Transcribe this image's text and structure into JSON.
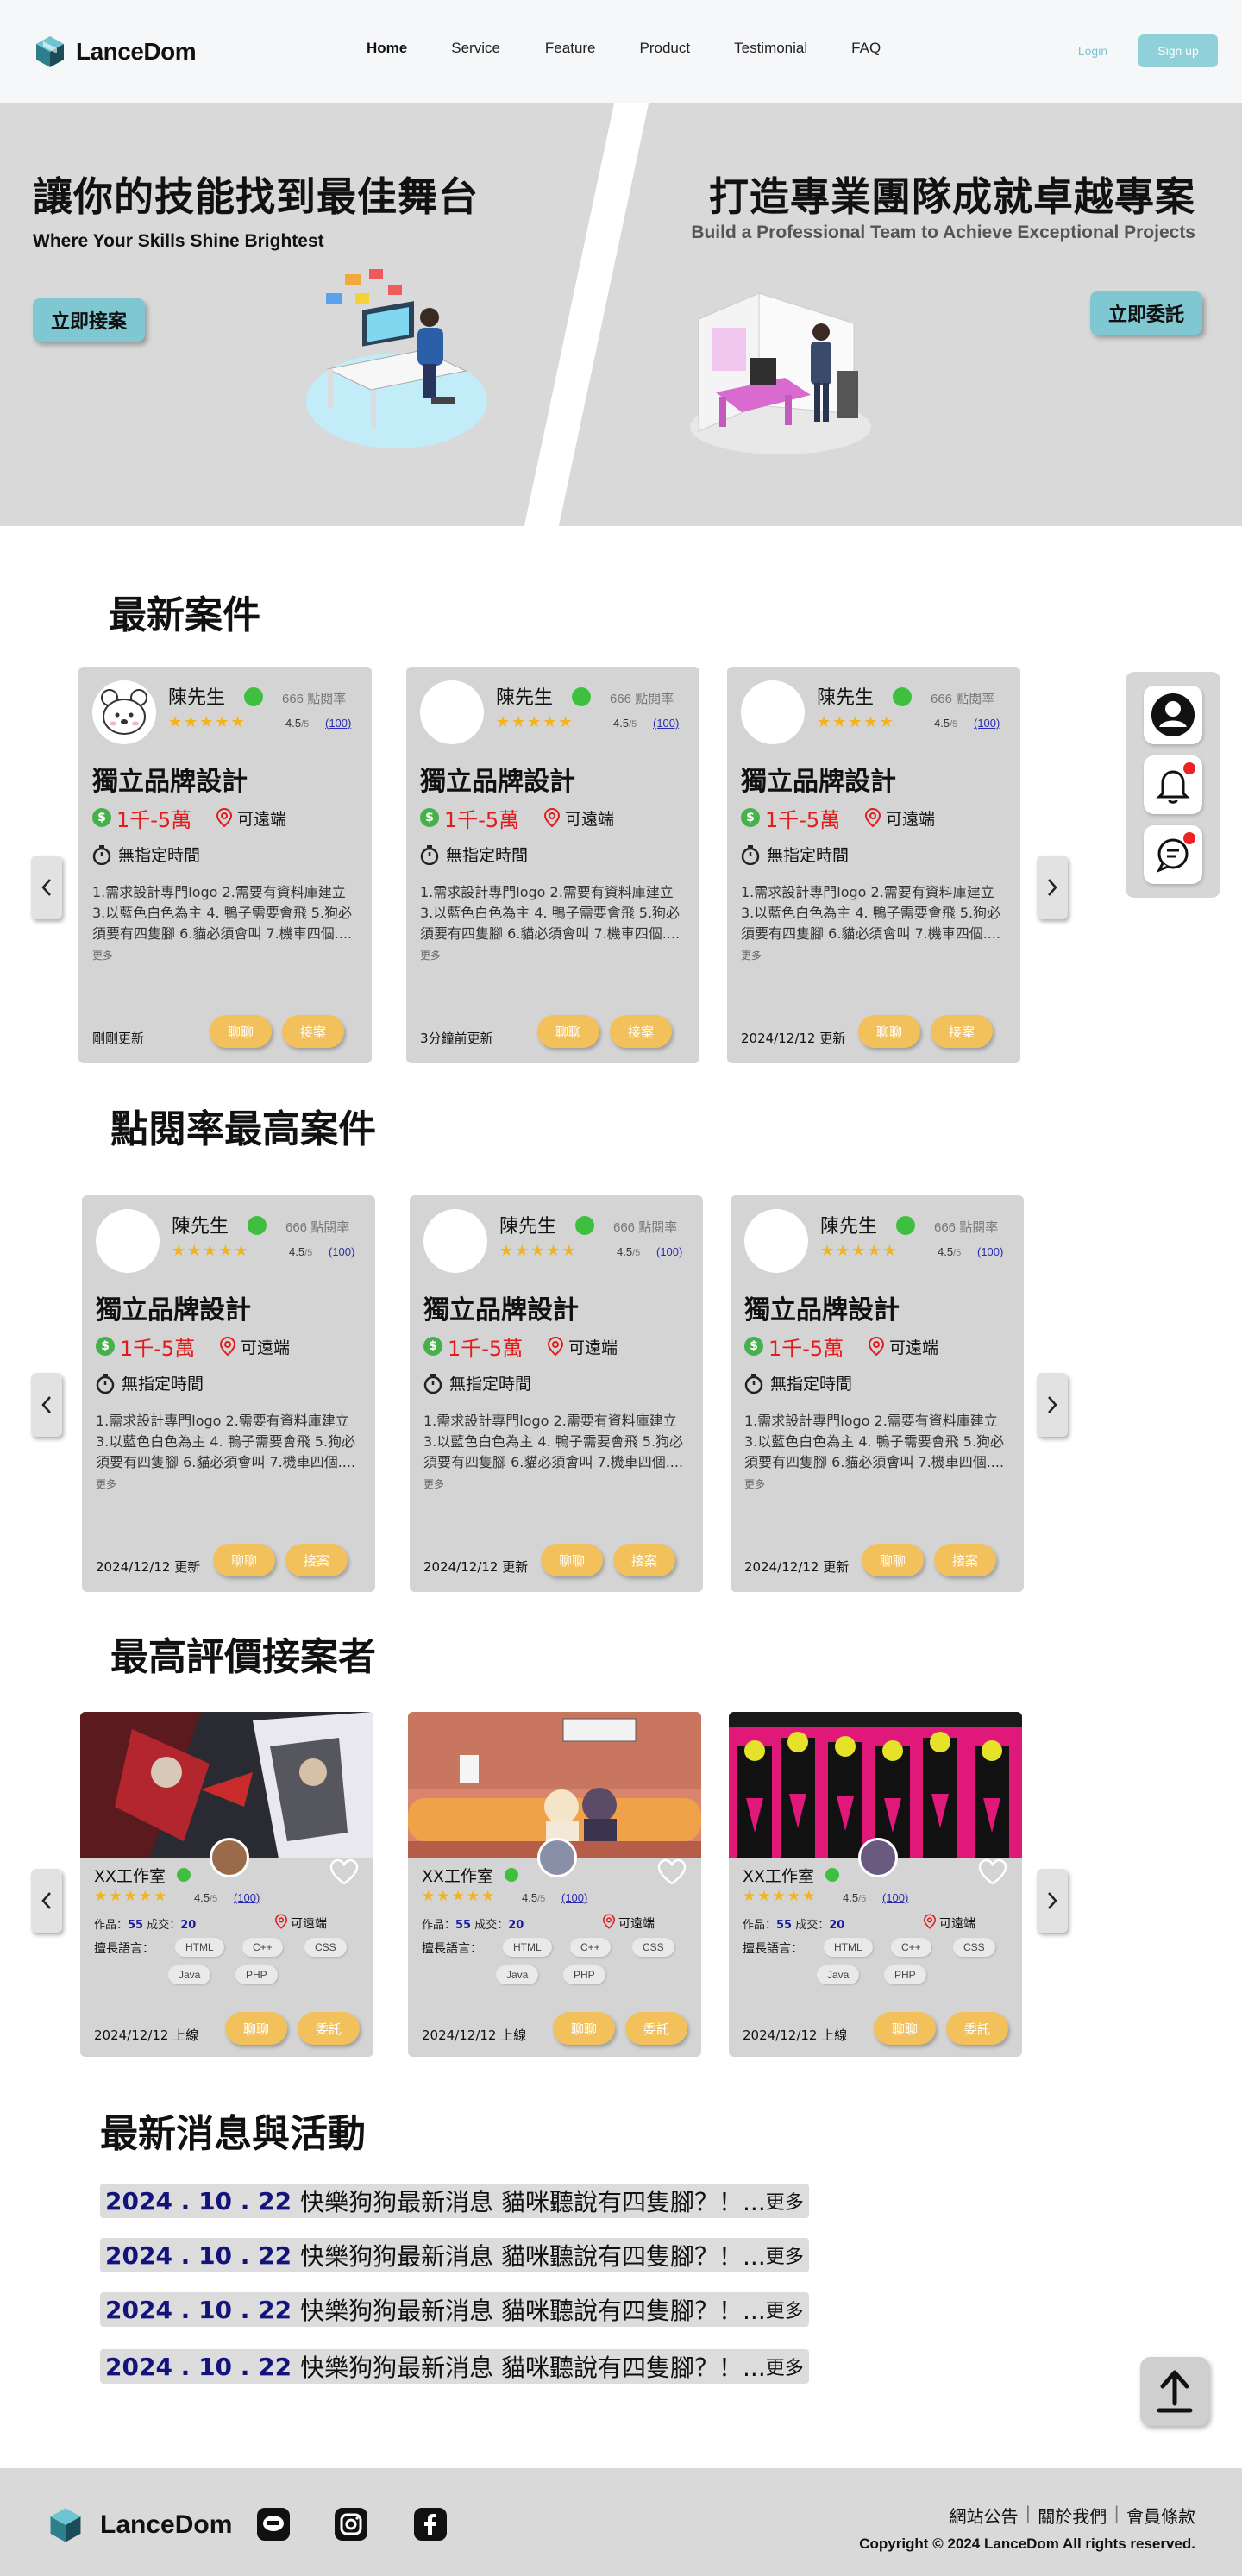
{
  "header": {
    "brand": "LanceDom",
    "nav": [
      "Home",
      "Service",
      "Feature",
      "Product",
      "Testimonial",
      "FAQ"
    ],
    "login": "Login",
    "signup": "Sign up"
  },
  "hero": {
    "left_title": "讓你的技能找到最佳舞台",
    "left_sub": "Where Your Skills Shine Brightest",
    "left_button": "立即接案",
    "right_title": "打造專業團隊成就卓越專案",
    "right_sub": "Build a Professional Team to Achieve Exceptional Projects",
    "right_button": "立即委託"
  },
  "sections": {
    "latest": "最新案件",
    "popular": "點閱率最高案件",
    "top_rated": "最高評價接案者",
    "news": "最新消息與活動"
  },
  "card_common": {
    "name": "陳先生",
    "views": "666 點閱率",
    "rating": "4.5",
    "rating_den": "/5",
    "rating_count": "(100)",
    "title": "獨立品牌設計",
    "budget": "1千-5萬",
    "location": "可遠端",
    "deadline": "無指定時間",
    "desc": "1.需求設計專門logo 2.需要有資料庫建立 3.以藍色白色為主 4. 鴨子需要會飛 5.狗必須要有四隻腳 6.貓必須會叫 7.機車四個....",
    "more": "更多",
    "chat": "聊聊",
    "accept": "接案"
  },
  "latest_cards": [
    {
      "updated": "剛剛更新"
    },
    {
      "updated": "3分鐘前更新"
    },
    {
      "updated": "2024/12/12 更新"
    }
  ],
  "popular_cards": [
    {
      "updated": "2024/12/12 更新"
    },
    {
      "updated": "2024/12/12 更新"
    },
    {
      "updated": "2024/12/12 更新"
    }
  ],
  "freelancer_common": {
    "name": "XX工作室",
    "rating": "4.5",
    "rating_den": "/5",
    "rating_count": "(100)",
    "works_label": "作品：",
    "works": "55",
    "deals_label": "成交：",
    "deals": "20",
    "location": "可遠端",
    "skills_label": "擅長語言：",
    "skills": [
      "HTML",
      "C++",
      "CSS",
      "Java",
      "PHP"
    ],
    "updated": "2024/12/12 上線",
    "chat": "聊聊",
    "hire": "委託"
  },
  "news": [
    {
      "date": "2024 . 10 . 22",
      "text": "快樂狗狗最新消息 貓咪聽說有四隻腳？！...",
      "more": "更多"
    },
    {
      "date": "2024 . 10 . 22",
      "text": "快樂狗狗最新消息 貓咪聽說有四隻腳？！...",
      "more": "更多"
    },
    {
      "date": "2024 . 10 . 22",
      "text": "快樂狗狗最新消息 貓咪聽說有四隻腳？！...",
      "more": "更多"
    },
    {
      "date": "2024 . 10 . 22",
      "text": "快樂狗狗最新消息 貓咪聽說有四隻腳？！...",
      "more": "更多"
    }
  ],
  "footer": {
    "brand": "LanceDom",
    "links": [
      "網站公告",
      "關於我們",
      "會員條款"
    ],
    "copyright": "Copyright © 2024 LanceDom All rights reserved."
  },
  "colors": {
    "accent": "#8fd0d9",
    "button_yellow": "#f2c15c",
    "online_green": "#3fbf3f",
    "budget_red": "#e31b1b",
    "card_bg": "#d4d4d4"
  }
}
